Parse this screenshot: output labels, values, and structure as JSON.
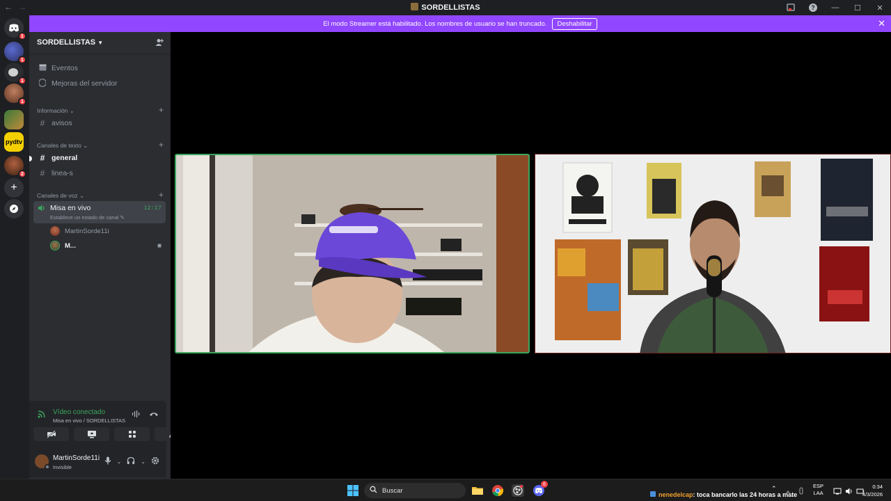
{
  "window": {
    "title": "SORDELLISTAS",
    "help_glyph": "?",
    "min_glyph": "—",
    "max_glyph": "☐",
    "close_glyph": "✕"
  },
  "banner": {
    "text": "El modo Streamer está habilitado. Los nombres de usuario se han truncado.",
    "button": "Deshabilitar"
  },
  "guilds": {
    "badges": [
      "1",
      "1",
      "1",
      "1",
      "2"
    ]
  },
  "sidebar": {
    "server_name": "SORDELLISTAS",
    "top_items": [
      {
        "label": "Eventos",
        "icon": "calendar-icon"
      },
      {
        "label": "Mejoras del servidor",
        "icon": "boost-icon"
      }
    ],
    "categories": [
      {
        "label": "Información",
        "channels": [
          {
            "label": "avisos"
          }
        ]
      },
      {
        "label": "Canales de texto",
        "channels": [
          {
            "label": "general"
          },
          {
            "label": "linea-s"
          }
        ]
      },
      {
        "label": "Canales de voz"
      }
    ],
    "voice_channel": {
      "name": "Misa en vivo",
      "status": "Establece un estado de canal",
      "time": "12:17",
      "users": [
        {
          "name": "MartinSorde11i"
        },
        {
          "name": "M..."
        }
      ]
    }
  },
  "rtc": {
    "connection": "Vídeo conectado",
    "location": "Misa en vivo / SORDELLISTAS"
  },
  "user": {
    "name": "MartinSorde11i",
    "status": "Invisible"
  },
  "taskbar": {
    "search": "Buscar",
    "discord_badge": "6",
    "notification_nick": "nenedelcap",
    "notification_msg": ": toca bancarlo las 24 horas a mate",
    "lang_1": "ESP",
    "lang_2": "LAA",
    "time": "0:34",
    "date": "4/3/2026"
  },
  "colors": {
    "accent": "#9146ff",
    "connected": "#3ba55c",
    "speaking_border": "#3ba55c",
    "badge": "#f23f43"
  }
}
